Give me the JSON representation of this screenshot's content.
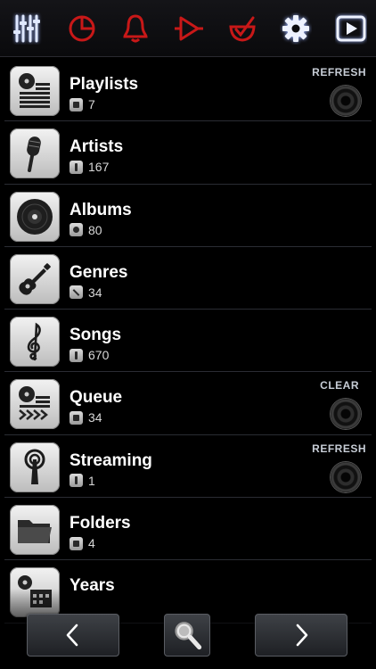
{
  "toolbar": {
    "buttons": [
      {
        "name": "equalizer-icon",
        "color": "#dfe8ff"
      },
      {
        "name": "pie-chart-icon",
        "color": "#c81818"
      },
      {
        "name": "bell-icon",
        "color": "#c81818"
      },
      {
        "name": "play-outline-icon",
        "color": "#c81818"
      },
      {
        "name": "check-bowl-icon",
        "color": "#c81818"
      },
      {
        "name": "gear-icon",
        "color": "#eef2ff"
      },
      {
        "name": "now-playing-icon",
        "color": "#eef2ff"
      }
    ]
  },
  "library": [
    {
      "title": "Playlists",
      "count": "7",
      "icon": "playlist-icon",
      "action": "REFRESH"
    },
    {
      "title": "Artists",
      "count": "167",
      "icon": "microphone-icon",
      "action": ""
    },
    {
      "title": "Albums",
      "count": "80",
      "icon": "disc-icon",
      "action": ""
    },
    {
      "title": "Genres",
      "count": "34",
      "icon": "guitar-icon",
      "action": ""
    },
    {
      "title": "Songs",
      "count": "670",
      "icon": "treble-clef-icon",
      "action": ""
    },
    {
      "title": "Queue",
      "count": "34",
      "icon": "queue-icon",
      "action": "CLEAR"
    },
    {
      "title": "Streaming",
      "count": "1",
      "icon": "antenna-icon",
      "action": "REFRESH"
    },
    {
      "title": "Folders",
      "count": "4",
      "icon": "folder-icon",
      "action": ""
    },
    {
      "title": "Years",
      "count": "",
      "icon": "calendar-icon",
      "action": ""
    }
  ],
  "bottom": {
    "prev_icon": "chevron-left-icon",
    "search_icon": "search-icon",
    "next_icon": "chevron-right-icon"
  },
  "colors": {
    "accent_red": "#c81818",
    "glow_white": "#eef2ff",
    "separator": "#2a2c33"
  }
}
